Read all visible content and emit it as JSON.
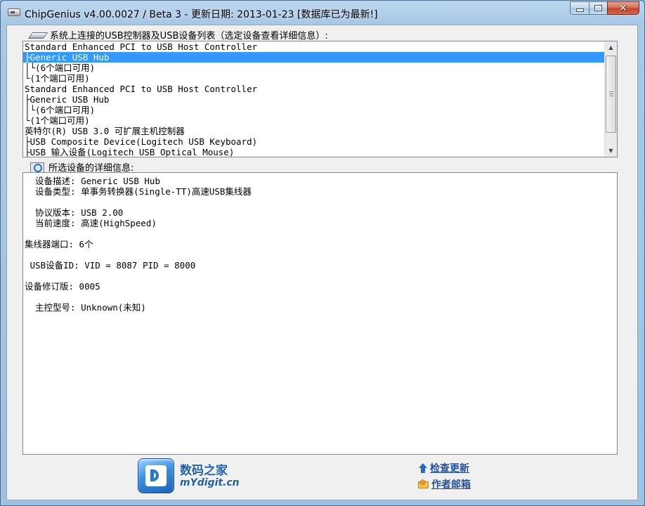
{
  "window": {
    "title": "ChipGenius v4.00.0027 / Beta 3 - 更新日期: 2013-01-23 [数据库已为最新!]",
    "close_glyph": "✕"
  },
  "device_list": {
    "label": "系统上连接的USB控制器及USB设备列表（选定设备查看详细信息）:",
    "rows": [
      "Standard Enhanced PCI to USB Host Controller",
      "├Generic USB Hub",
      "│└(6个端口可用)",
      "└(1个端口可用)",
      "Standard Enhanced PCI to USB Host Controller",
      "├Generic USB Hub",
      "│└(6个端口可用)",
      "└(1个端口可用)",
      "英特尔(R) USB 3.0 可扩展主机控制器",
      "├USB Composite Device(Logitech USB Keyboard)",
      "├USB 输入设备(Logitech USB Optical Mouse)"
    ],
    "selected_index": 1
  },
  "details": {
    "label": "所选设备的详细信息:",
    "lines": [
      "  设备描述: Generic USB Hub",
      "  设备类型: 单事务转换器(Single-TT)高速USB集线器",
      "",
      "  协议版本: USB 2.00",
      "  当前速度: 高速(HighSpeed)",
      "",
      "集线器端口: 6个",
      "",
      " USB设备ID: VID = 8087 PID = 8000",
      "",
      "设备修订版: 0005",
      "",
      "  主控型号: Unknown(未知)"
    ]
  },
  "footer": {
    "logo_cn": "数码之家",
    "logo_en": "mYdigit.cn",
    "check_update": "检查更新",
    "author_mail": "作者邮箱"
  },
  "colors": {
    "selection": "#3399ff",
    "link": "#1f4f9e"
  }
}
